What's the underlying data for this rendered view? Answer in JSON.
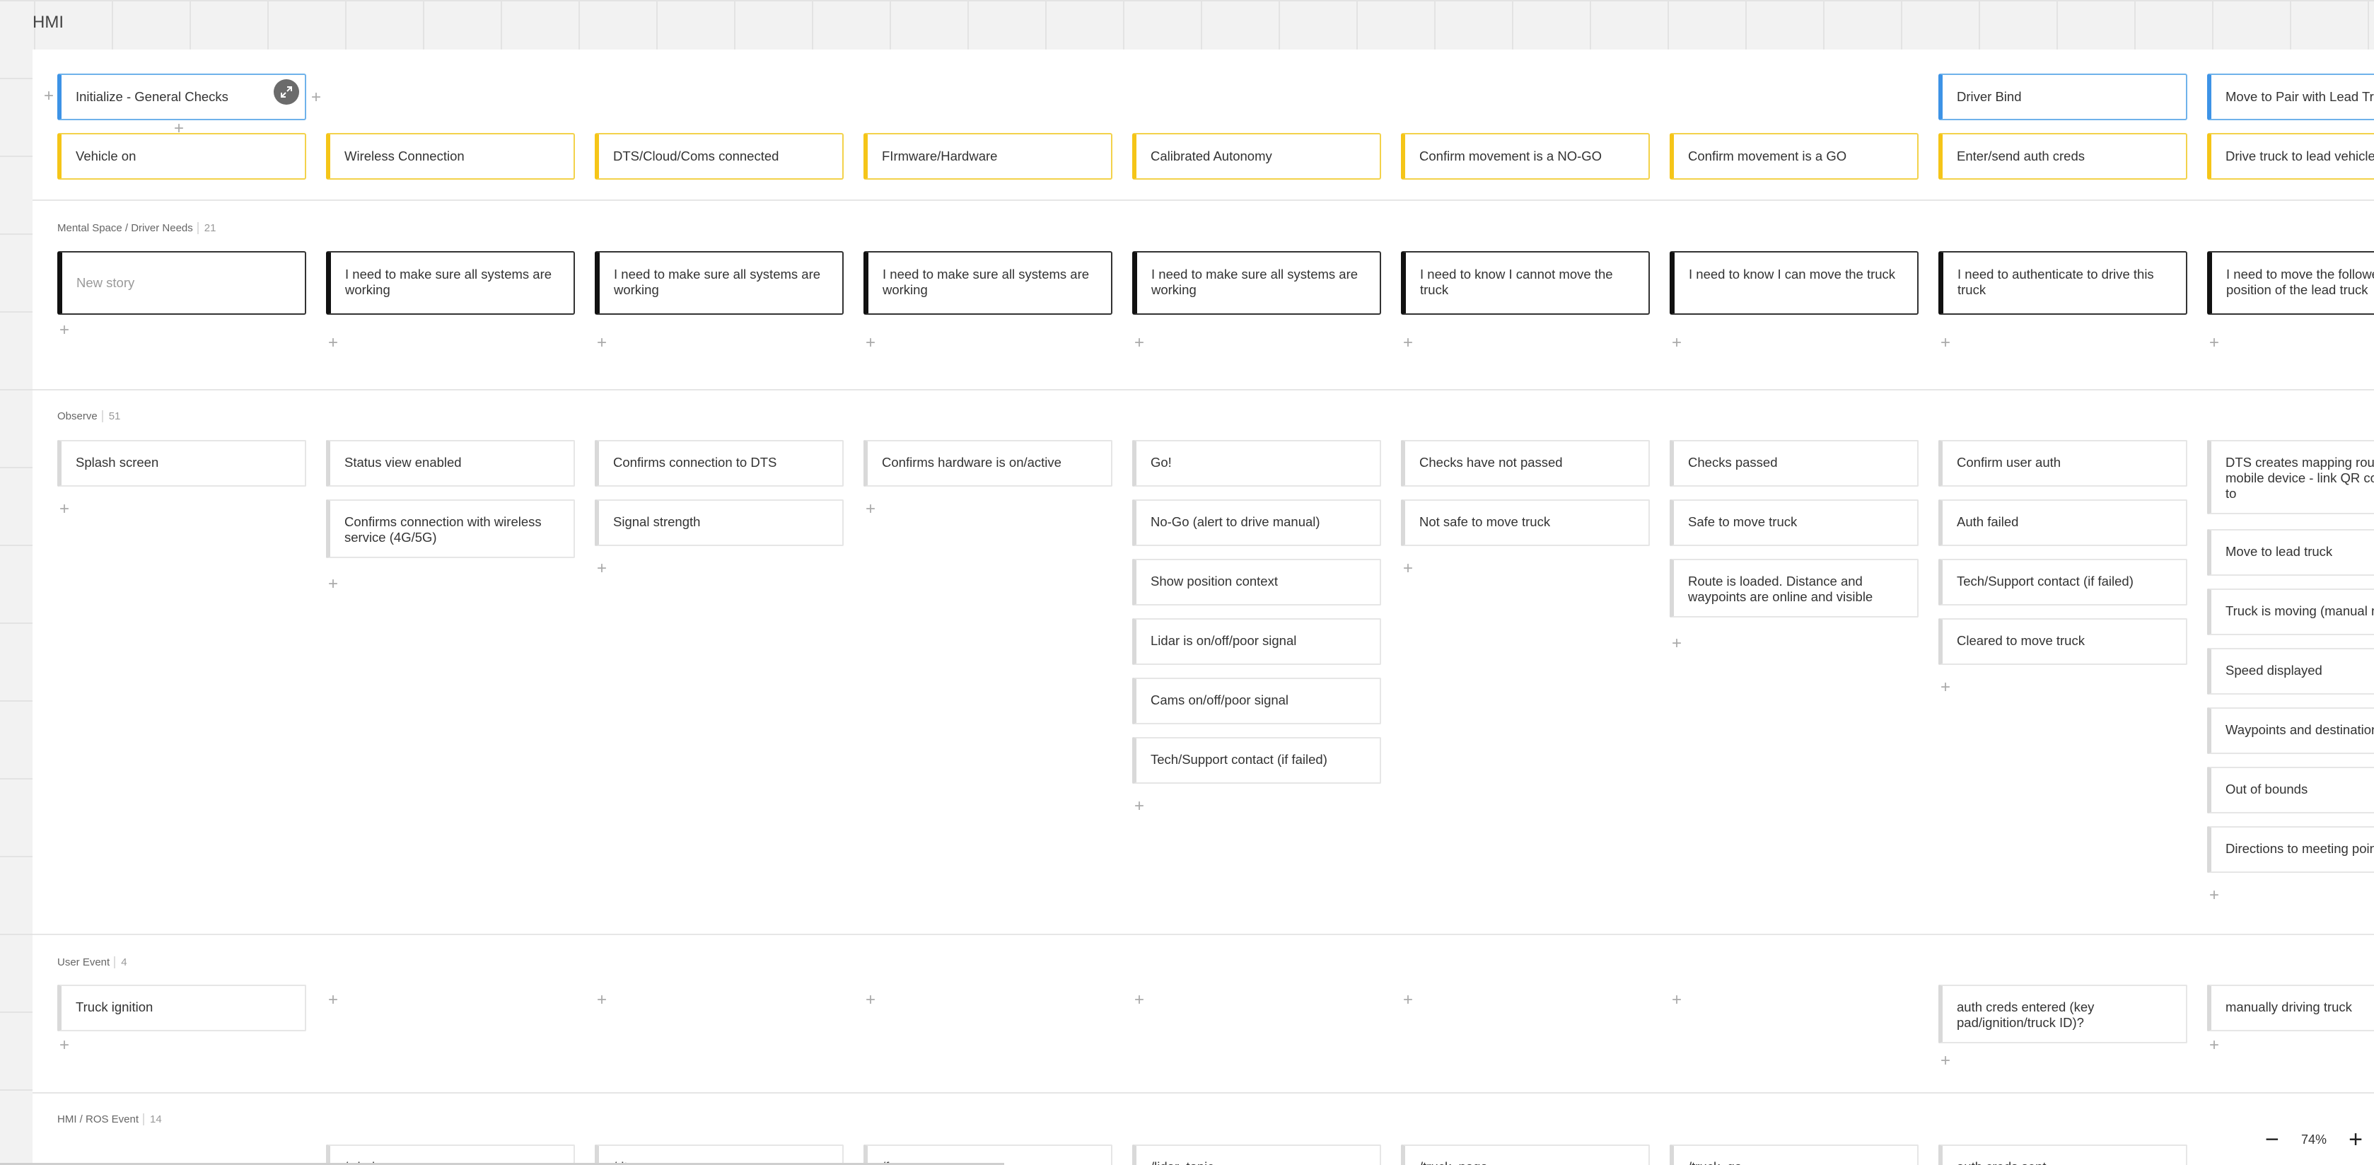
{
  "board": {
    "title": "HMI"
  },
  "columns": [
    {
      "activity": "Initialize - General Checks",
      "step": "Vehicle on",
      "need": "New story",
      "need_placeholder": true,
      "observe": [
        "Splash screen"
      ],
      "user_event": [
        "Truck ignition"
      ],
      "ros_event": [
        ""
      ]
    },
    {
      "activity": "",
      "step": "Wireless Connection",
      "need": "I need to make sure all systems are working",
      "observe": [
        "Status view enabled",
        "Confirms connection with wireless service (4G/5G)"
      ],
      "user_event": [],
      "ros_event": [
        "/wireless_on"
      ]
    },
    {
      "activity": "",
      "step": "DTS/Cloud/Coms connected",
      "need": "I need to make sure all systems are working",
      "observe": [
        "Confirms connection to DTS",
        "Signal strength"
      ],
      "user_event": [],
      "ros_event": [
        "/dts_on"
      ]
    },
    {
      "activity": "",
      "step": "FIrmware/Hardware",
      "need": "I need to make sure all systems are working",
      "observe": [
        "Confirms hardware is on/active"
      ],
      "user_event": [],
      "ros_event": [
        "/fw_on"
      ]
    },
    {
      "activity": "",
      "step": "Calibrated Autonomy",
      "need": "I need to make sure all systems are working",
      "observe": [
        "Go!",
        "No-Go (alert to drive manual)",
        "Show position context",
        "Lidar is on/off/poor signal",
        "Cams on/off/poor signal",
        "Tech/Support contact (if failed)"
      ],
      "user_event": [],
      "ros_event": [
        "/lidar_topic"
      ]
    },
    {
      "activity": "",
      "step": "Confirm movement is a NO-GO",
      "need": "I need to know I cannot move the truck",
      "observe": [
        "Checks have not passed",
        "Not safe to move truck"
      ],
      "user_event": [],
      "ros_event": [
        "/truck_nogo"
      ]
    },
    {
      "activity": "",
      "step": "Confirm movement is a GO",
      "need": "I need to know I can move the truck",
      "observe": [
        "Checks passed",
        "Safe to move truck",
        "Route is loaded. Distance and waypoints are online and visible"
      ],
      "user_event": [],
      "ros_event": [
        "/truck_go"
      ]
    },
    {
      "activity": "Driver Bind",
      "step": "Enter/send auth creds",
      "need": "I need to authenticate to drive this truck",
      "observe": [
        "Confirm user auth",
        "Auth failed",
        "Tech/Support contact (if failed)",
        "Cleared to move truck"
      ],
      "user_event": [
        "auth creds entered (key pad/ignition/truck ID)?"
      ],
      "ros_event": [
        "auth creds sent"
      ]
    },
    {
      "activity": "Move to Pair with Lead Truck",
      "step": "Drive truck to lead vehicle",
      "need": "I need to move the follower truck into position of the lead truck",
      "observe": [
        "DTS creates mapping route on driver mobile device - link QR code - points to",
        "Move to lead truck",
        "Truck is moving (manual mode)",
        "Speed displayed",
        "Waypoints and destination",
        "Out of bounds",
        "Directions to meeting point QR Code"
      ],
      "user_event": [
        "manually driving truck"
      ],
      "ros_event": [
        ""
      ]
    }
  ],
  "lanes": {
    "needs": {
      "label": "Mental Space / Driver Needs",
      "count": "21"
    },
    "observe": {
      "label": "Observe",
      "count": "51"
    },
    "user_event": {
      "label": "User Event",
      "count": "4"
    },
    "ros_event": {
      "label": "HMI / ROS Event",
      "count": "14"
    }
  },
  "zoom": {
    "level": "74%",
    "minus": "−",
    "plus": "+"
  },
  "icons": {
    "add": "plus-icon",
    "expand": "expand-icon"
  }
}
